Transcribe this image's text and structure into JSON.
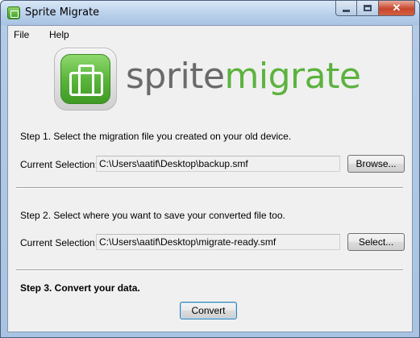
{
  "window": {
    "title": "Sprite Migrate",
    "close_glyph": "✕"
  },
  "menu": {
    "file": "File",
    "help": "Help"
  },
  "logo": {
    "part1": "sprite",
    "part2": "migrate",
    "color_sprite": "#6a6a6a",
    "color_migrate": "#5cb23e"
  },
  "step1": {
    "text": "Step 1. Select the migration file you created on your old device.",
    "label": "Current Selection:",
    "value": "C:\\Users\\aatif\\Desktop\\backup.smf",
    "button": "Browse..."
  },
  "step2": {
    "text": "Step 2. Select where you want to save your converted file too.",
    "label": "Current Selection:",
    "value": "C:\\Users\\aatif\\Desktop\\migrate-ready.smf",
    "button": "Select..."
  },
  "step3": {
    "text": "Step 3. Convert your data.",
    "button": "Convert"
  }
}
